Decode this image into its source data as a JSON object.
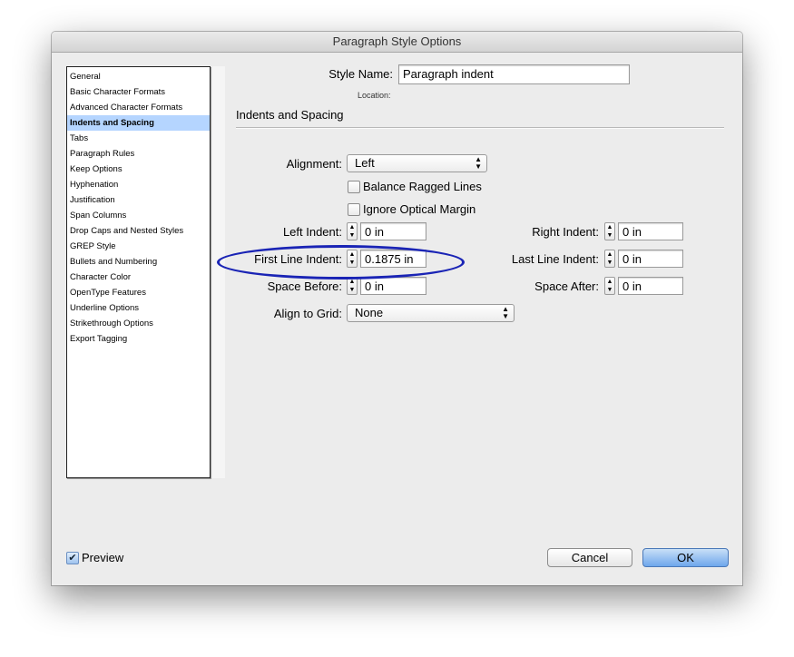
{
  "window": {
    "title": "Paragraph Style Options"
  },
  "sidebar": {
    "items": [
      {
        "label": "General"
      },
      {
        "label": "Basic Character Formats"
      },
      {
        "label": "Advanced Character Formats"
      },
      {
        "label": "Indents and Spacing",
        "selected": true
      },
      {
        "label": "Tabs"
      },
      {
        "label": "Paragraph Rules"
      },
      {
        "label": "Keep Options"
      },
      {
        "label": "Hyphenation"
      },
      {
        "label": "Justification"
      },
      {
        "label": "Span Columns"
      },
      {
        "label": "Drop Caps and Nested Styles"
      },
      {
        "label": "GREP Style"
      },
      {
        "label": "Bullets and Numbering"
      },
      {
        "label": "Character Color"
      },
      {
        "label": "OpenType Features"
      },
      {
        "label": "Underline Options"
      },
      {
        "label": "Strikethrough Options"
      },
      {
        "label": "Export Tagging"
      }
    ]
  },
  "style_name": {
    "label": "Style Name:",
    "value": "Paragraph indent",
    "location_label": "Location:"
  },
  "section": {
    "title": "Indents and Spacing"
  },
  "alignment": {
    "label": "Alignment:",
    "value": "Left"
  },
  "balance_ragged": {
    "label": "Balance Ragged Lines",
    "checked": false
  },
  "ignore_optical": {
    "label": "Ignore Optical Margin",
    "checked": false
  },
  "left_indent": {
    "label": "Left Indent:",
    "value": "0 in"
  },
  "right_indent": {
    "label": "Right Indent:",
    "value": "0 in"
  },
  "first_line_indent": {
    "label": "First Line Indent:",
    "value": "0.1875 in"
  },
  "last_line_indent": {
    "label": "Last Line Indent:",
    "value": "0 in"
  },
  "space_before": {
    "label": "Space Before:",
    "value": "0 in"
  },
  "space_after": {
    "label": "Space After:",
    "value": "0 in"
  },
  "align_to_grid": {
    "label": "Align to Grid:",
    "value": "None"
  },
  "preview": {
    "label": "Preview",
    "checked": true
  },
  "buttons": {
    "cancel": "Cancel",
    "ok": "OK"
  },
  "colors": {
    "highlight": "#1a24b5",
    "selection": "#b5d5ff",
    "ok_button": "#6ea7ec"
  }
}
